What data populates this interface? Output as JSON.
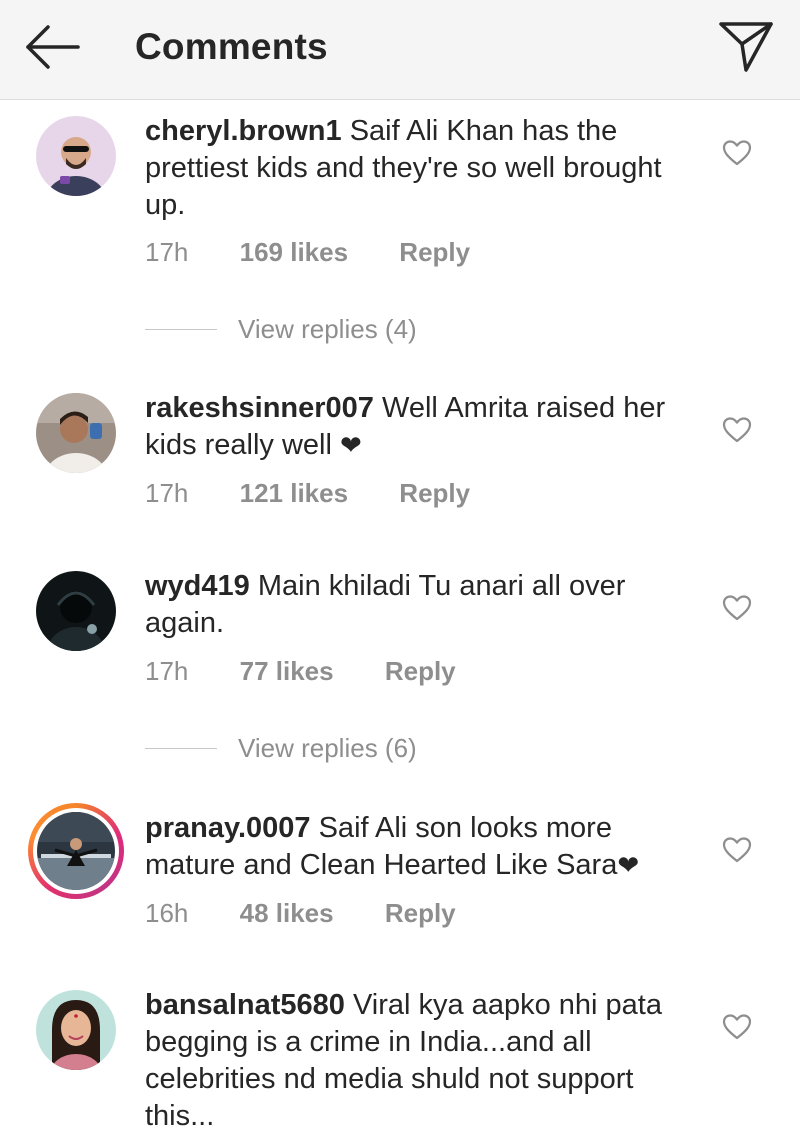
{
  "header": {
    "title": "Comments",
    "back_icon": "arrow-left-icon",
    "share_icon": "paper-plane-icon"
  },
  "comments": [
    {
      "username": "cheryl.brown1",
      "text": "Saif Ali Khan has the prettiest kids and they're so well brought up.",
      "time": "17h",
      "likes": "169 likes",
      "reply": "Reply",
      "view_replies": "View replies (4)"
    },
    {
      "username": "rakeshsinner007",
      "text": "Well Amrita raised her kids really well",
      "emoji": "❤",
      "time": "17h",
      "likes": "121 likes",
      "reply": "Reply"
    },
    {
      "username": "wyd419",
      "text": "Main khiladi Tu anari all over again.",
      "time": "17h",
      "likes": "77 likes",
      "reply": "Reply",
      "view_replies": "View replies (6)"
    },
    {
      "username": "pranay.0007",
      "text": "Saif Ali son looks more mature and Clean Hearted Like Sara",
      "emoji": "❤",
      "time": "16h",
      "likes": "48 likes",
      "reply": "Reply"
    },
    {
      "username": "bansalnat5680",
      "text": "Viral kya aapko nhi pata begging is a crime in India...and all celebrities nd media shuld not support this..."
    }
  ],
  "colors": {
    "header_bg": "#f5f5f5",
    "text": "#262626",
    "muted": "#8e8e8e",
    "divider": "#c7c7c7"
  }
}
